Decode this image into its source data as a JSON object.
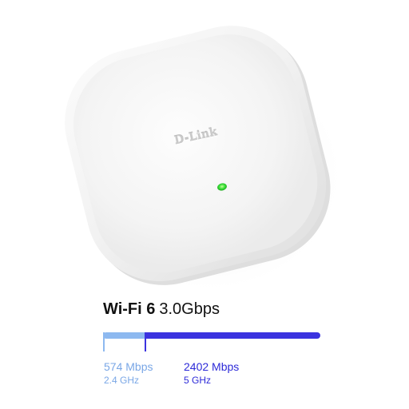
{
  "product": {
    "brand": "D-Link",
    "status_led_color": "#39e039"
  },
  "spec": {
    "standard": "Wi-Fi 6",
    "total_speed": "3.0Gbps",
    "total_mbps": 2976
  },
  "bands": [
    {
      "rate_label": "574 Mbps",
      "freq_label": "2.4 GHz",
      "mbps": 574,
      "color": "#8db9f0",
      "text_color": "#7aa7e6"
    },
    {
      "rate_label": "2402 Mbps",
      "freq_label": "5 GHz",
      "mbps": 2402,
      "color": "#3b33df",
      "text_color": "#2d2ad8"
    }
  ]
}
